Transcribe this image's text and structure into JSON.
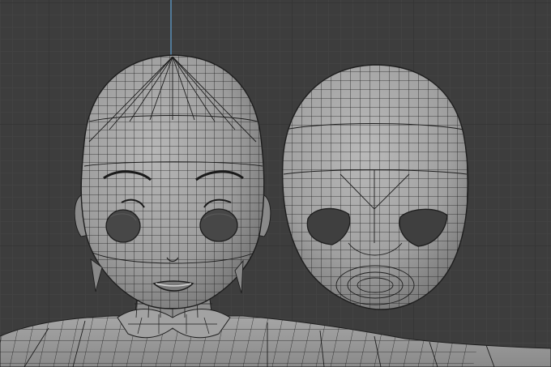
{
  "viewport": {
    "background": "#3d3d3d",
    "grid_minor_color": "#464646",
    "grid_major_color": "#323232",
    "z_axis_color": "#5b8fb8"
  },
  "mesh": {
    "surface_color": "#9a9a9a",
    "surface_light": "#b4b4b4",
    "surface_dark": "#6c6c6c",
    "wire_color": "#1e1e1e",
    "objects": [
      "character-head-mesh",
      "face-shell-mesh",
      "body-mesh"
    ]
  }
}
